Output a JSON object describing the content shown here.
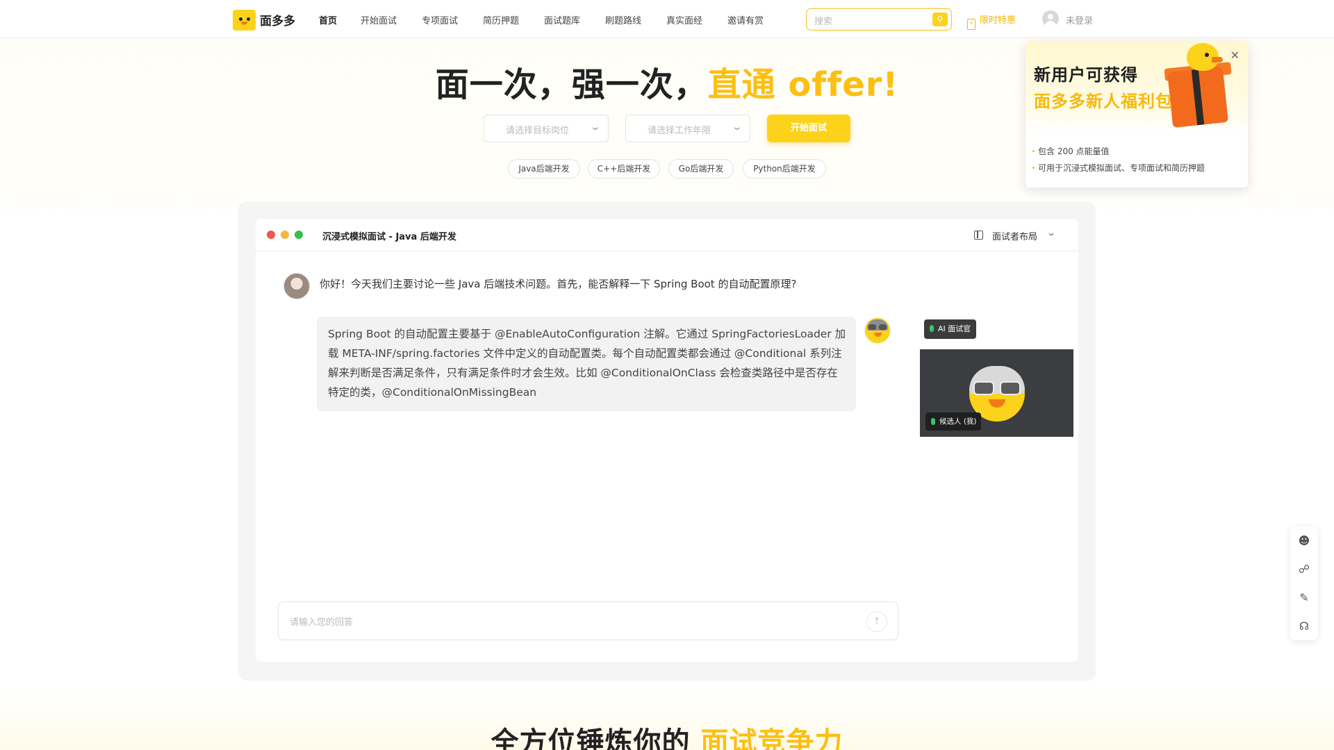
{
  "brand": {
    "name": "面多多"
  },
  "nav": {
    "items": [
      {
        "label": "首页",
        "active": true
      },
      {
        "label": "开始面试"
      },
      {
        "label": "专项面试"
      },
      {
        "label": "简历押题"
      },
      {
        "label": "面试题库"
      },
      {
        "label": "刷题路线"
      },
      {
        "label": "真实面经"
      },
      {
        "label": "邀请有赏"
      }
    ],
    "search_placeholder": "搜索",
    "promo_label": "限时特惠",
    "login_label": "未登录"
  },
  "hero": {
    "title_part1": "面一次，强一次，",
    "title_highlight": "直通 offer!",
    "select_position_placeholder": "请选择目标岗位",
    "select_years_placeholder": "请选择工作年限",
    "start_button": "开始面试",
    "chips": [
      "Java后端开发",
      "C++后端开发",
      "Go后端开发",
      "Python后端开发"
    ]
  },
  "promo_popup": {
    "line1": "新用户可获得",
    "line2": "面多多新人福利包",
    "bullets": [
      "包含 200 点能量值",
      "可用于沉浸式模拟面试、专项面试和简历押题"
    ]
  },
  "interview": {
    "window_title": "沉浸式模拟面试 - Java 后端开发",
    "layout_label": "面试者布局",
    "question": "你好！今天我们主要讨论一些 Java 后端技术问题。首先，能否解释一下 Spring Boot 的自动配置原理?",
    "answer": "Spring Boot 的自动配置主要基于 @EnableAutoConfiguration 注解。它通过 SpringFactoriesLoader 加载 META-INF/spring.factories 文件中定义的自动配置类。每个自动配置类都会通过 @Conditional 系列注解来判断是否满足条件，只有满足条件时才会生效。比如 @ConditionalOnClass 会检查类路径中是否存在特定的类，@ConditionalOnMissingBean",
    "ai_badge": "AI 面试官",
    "candidate_badge": "候选人 (我)",
    "input_placeholder": "请输入您的回答"
  },
  "section": {
    "title_part1": "全方位锤炼你的 ",
    "title_highlight": "面试竞争力"
  },
  "colors": {
    "brand_yellow": "#fcd31a",
    "accent": "#fcbf12",
    "window_red": "#f2554d",
    "window_yellow": "#f6b73a",
    "window_green": "#33c048"
  }
}
